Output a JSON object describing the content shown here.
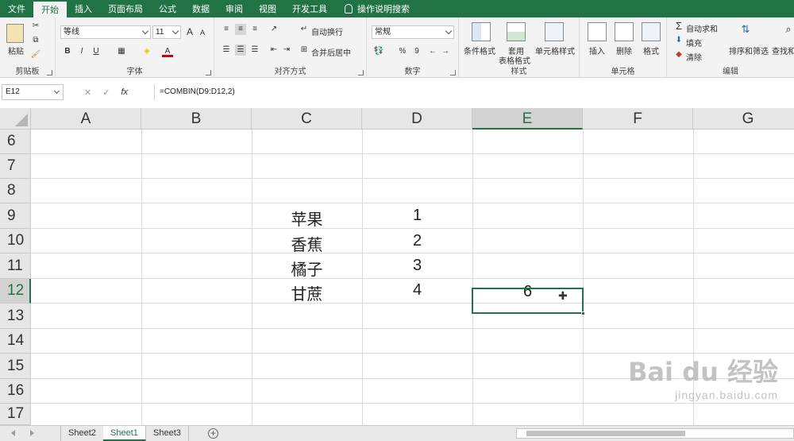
{
  "ribbon_tabs": [
    "文件",
    "开始",
    "插入",
    "页面布局",
    "公式",
    "数据",
    "审阅",
    "视图",
    "开发工具"
  ],
  "tell_me": "操作说明搜索",
  "clipboard": {
    "paste": "粘贴",
    "label": "剪贴板"
  },
  "font": {
    "name": "等线",
    "size": "11",
    "grow": "A",
    "shrink": "A",
    "bold": "B",
    "italic": "I",
    "underline": "U",
    "font_color": "A",
    "label": "字体"
  },
  "alignment": {
    "wrap_text": "自动换行",
    "merge_center": "合并后居中",
    "label": "对齐方式"
  },
  "number": {
    "format": "常规",
    "percent": "%",
    "comma": "9",
    "label": "数字"
  },
  "styles": {
    "conditional": "条件格式",
    "format_table_1": "套用",
    "format_table_2": "表格格式",
    "cell_styles": "单元格样式",
    "label": "样式"
  },
  "cells": {
    "insert": "插入",
    "delete": "删除",
    "format": "格式",
    "label": "单元格"
  },
  "editing": {
    "autosum": "自动求和",
    "fill": "填充",
    "clear": "清除",
    "sort_filter": "排序和筛选",
    "find_select": "查找和",
    "label": "编辑"
  },
  "formula_bar": {
    "name_box": "E12",
    "cancel": "✕",
    "enter": "✓",
    "fx": "fx",
    "formula": "=COMBIN(D9:D12,2)"
  },
  "columns": [
    "A",
    "B",
    "C",
    "D",
    "E",
    "F",
    "G"
  ],
  "rows": [
    "6",
    "7",
    "8",
    "9",
    "10",
    "11",
    "12",
    "13",
    "14",
    "15",
    "16",
    "17"
  ],
  "cells_data": {
    "C9": "苹果",
    "D9": "1",
    "C10": "香蕉",
    "D10": "2",
    "C11": "橘子",
    "D11": "3",
    "C12": "甘蔗",
    "D12": "4",
    "E12": "6"
  },
  "sheet_tabs": [
    "Sheet2",
    "Sheet1",
    "Sheet3"
  ],
  "active_sheet": "Sheet1",
  "watermark": {
    "logo": "Bai du 经验",
    "url": "jingyan.baidu.com"
  }
}
